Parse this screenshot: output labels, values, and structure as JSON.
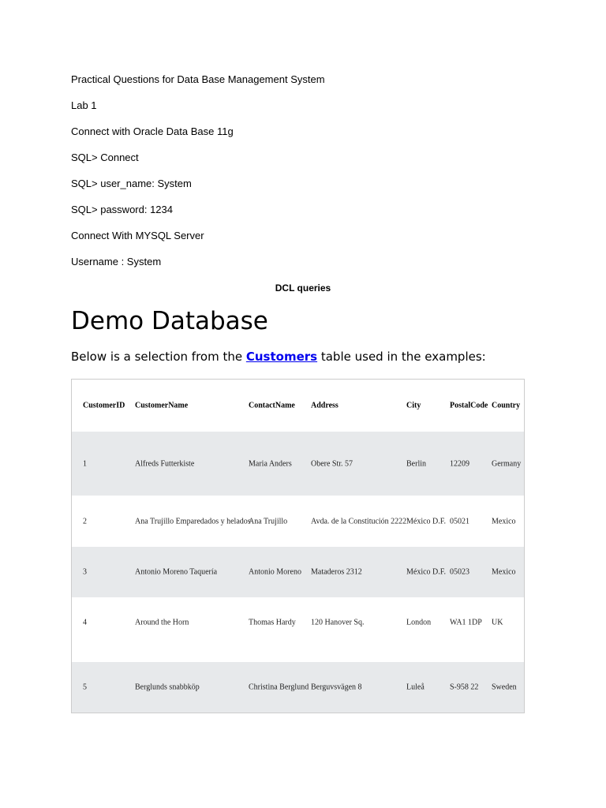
{
  "lines": [
    "Practical Questions for Data Base Management System",
    "Lab 1",
    "Connect with Oracle Data Base 11g",
    "SQL> Connect",
    "SQL> user_name: System",
    "SQL> password: 1234",
    "Connect With MYSQL Server",
    "Username : System"
  ],
  "section_title": "DCL queries",
  "heading": "Demo Database",
  "intro": {
    "before": "Below is a selection from the ",
    "link": "Customers",
    "after": " table used in the examples:"
  },
  "table": {
    "headers": [
      "CustomerID",
      "CustomerName",
      "ContactName",
      "Address",
      "City",
      "PostalCode",
      "Country"
    ],
    "rows": [
      [
        "1",
        "Alfreds Futterkiste",
        "Maria Anders",
        "Obere Str. 57",
        "Berlin",
        "12209",
        "Germany"
      ],
      [
        "2",
        "Ana Trujillo Emparedados y helados",
        "Ana Trujillo",
        "Avda. de la Constitución 2222",
        "México D.F.",
        "05021",
        "Mexico"
      ],
      [
        "3",
        "Antonio Moreno Taquería",
        "Antonio Moreno",
        "Mataderos 2312",
        "México D.F.",
        "05023",
        "Mexico"
      ],
      [
        "4",
        "Around the Horn",
        "Thomas Hardy",
        "120 Hanover Sq.",
        "London",
        "WA1 1DP",
        "UK"
      ],
      [
        "5",
        "Berglunds snabbköp",
        "Christina Berglund",
        "Berguvsvägen 8",
        "Luleå",
        "S-958 22",
        "Sweden"
      ]
    ]
  }
}
